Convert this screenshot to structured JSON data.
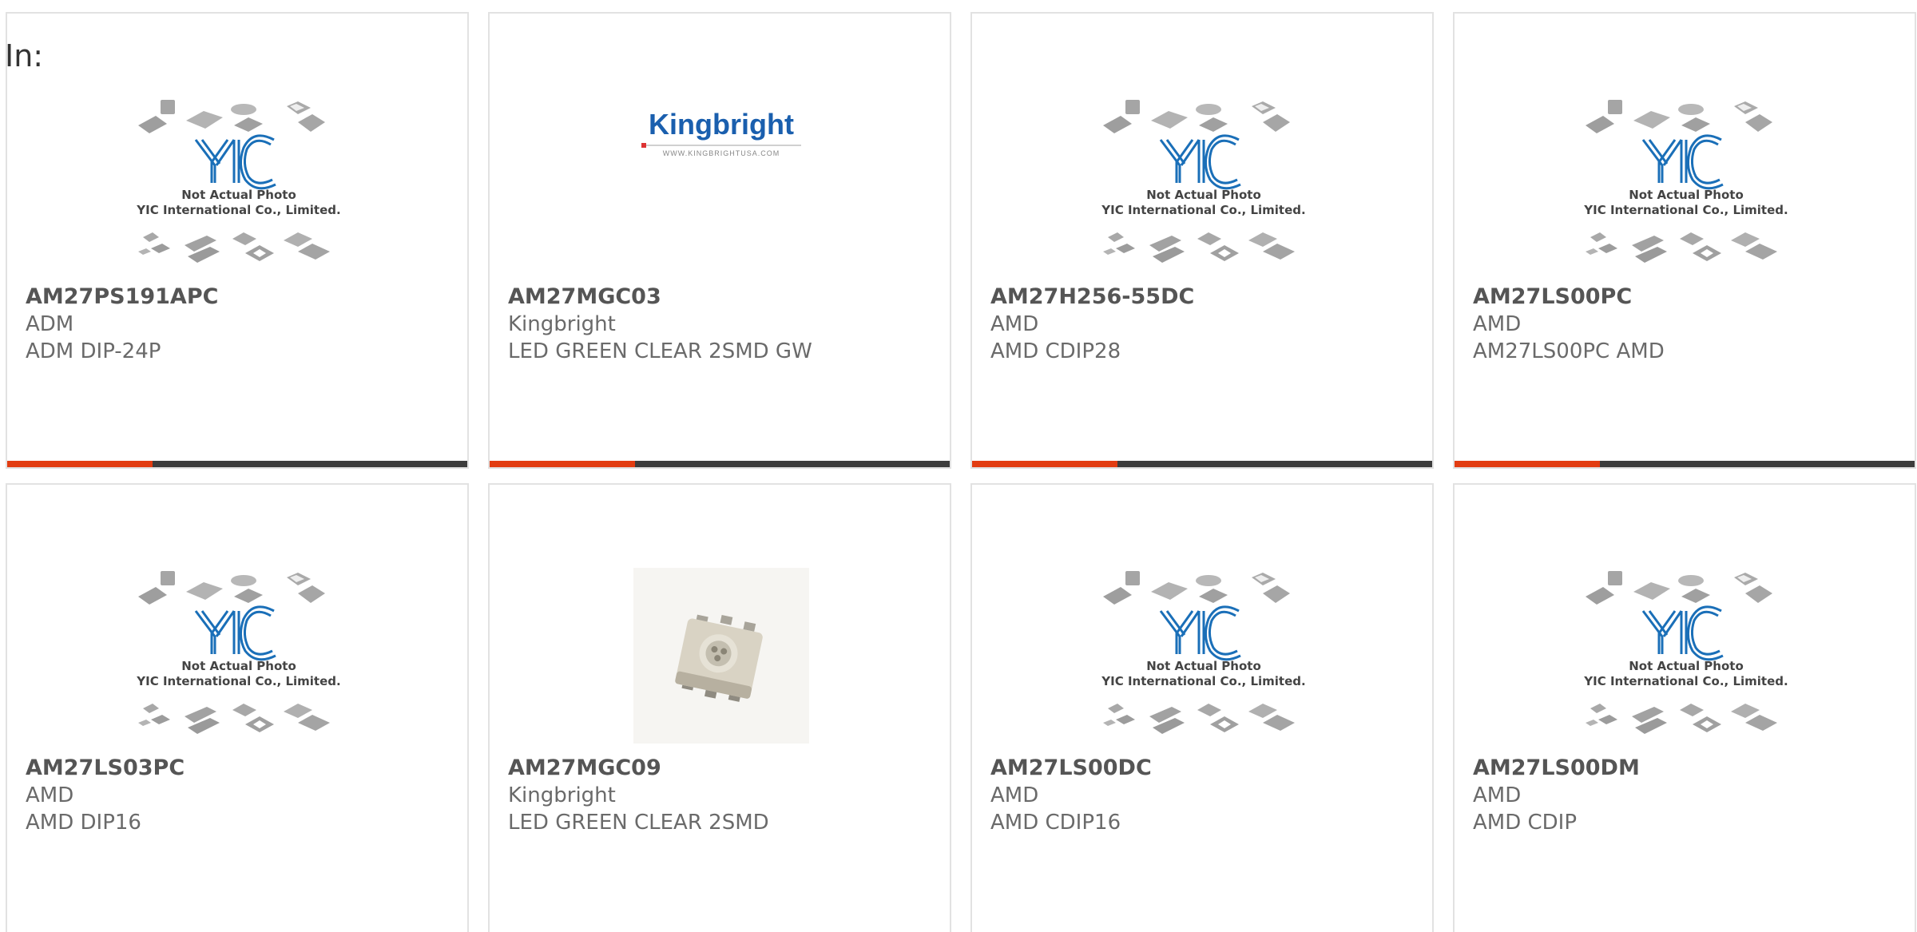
{
  "header": {
    "label": "In:"
  },
  "placeholder": {
    "logo_text": "YIC",
    "line1": "Not Actual Photo",
    "line2": "YIC International Co., Limited."
  },
  "kingbright_logo": {
    "name": "Kingbright",
    "url": "WWW.KINGBRIGHTUSA.COM"
  },
  "colors": {
    "accent": "#e23d12",
    "bar": "#3d3d3d",
    "yic_blue": "#1a6fb8",
    "kingbright_blue": "#1a5fae"
  },
  "products": [
    {
      "part_number": "AM27PS191APC",
      "manufacturer": "ADM",
      "description": "ADM DIP-24P",
      "image": "yic-placeholder"
    },
    {
      "part_number": "AM27MGC03",
      "manufacturer": "Kingbright",
      "description": "LED GREEN CLEAR 2SMD GW",
      "image": "kingbright-logo"
    },
    {
      "part_number": "AM27H256-55DC",
      "manufacturer": "AMD",
      "description": "AMD CDIP28",
      "image": "yic-placeholder"
    },
    {
      "part_number": "AM27LS00PC",
      "manufacturer": "AMD",
      "description": "AM27LS00PC AMD",
      "image": "yic-placeholder"
    },
    {
      "part_number": "AM27LS03PC",
      "manufacturer": "AMD",
      "description": "AMD DIP16",
      "image": "yic-placeholder"
    },
    {
      "part_number": "AM27MGC09",
      "manufacturer": "Kingbright",
      "description": "LED GREEN CLEAR 2SMD",
      "image": "smd-led-photo"
    },
    {
      "part_number": "AM27LS00DC",
      "manufacturer": "AMD",
      "description": "AMD CDIP16",
      "image": "yic-placeholder"
    },
    {
      "part_number": "AM27LS00DM",
      "manufacturer": "AMD",
      "description": "AMD CDIP",
      "image": "yic-placeholder"
    }
  ]
}
